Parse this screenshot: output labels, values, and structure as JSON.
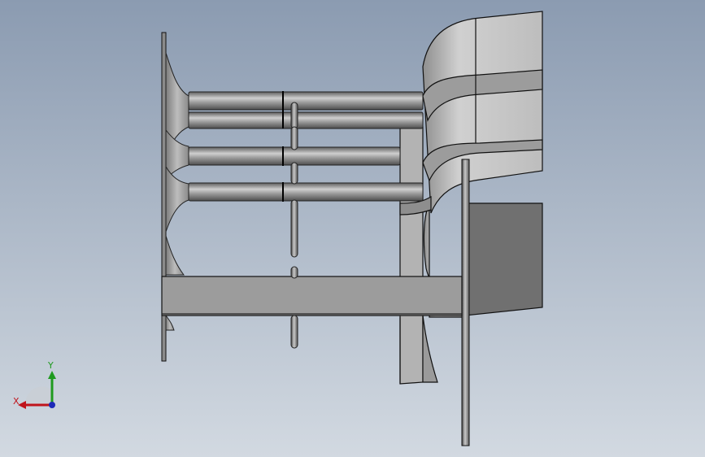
{
  "viewport": {
    "background_top": "#8b9bb1",
    "background_bottom": "#d2d9e1"
  },
  "model": {
    "body_color": "#a9a9a9",
    "dark_color": "#6e6e6e",
    "edge_color": "#111111",
    "face_light": "#c4c4c4",
    "face_dark": "#8a8a8a"
  },
  "triad": {
    "x_label": "X",
    "y_label": "Y",
    "x_color": "#c0141c",
    "y_color": "#1f9a1f",
    "z_color": "#1d2ab8"
  }
}
